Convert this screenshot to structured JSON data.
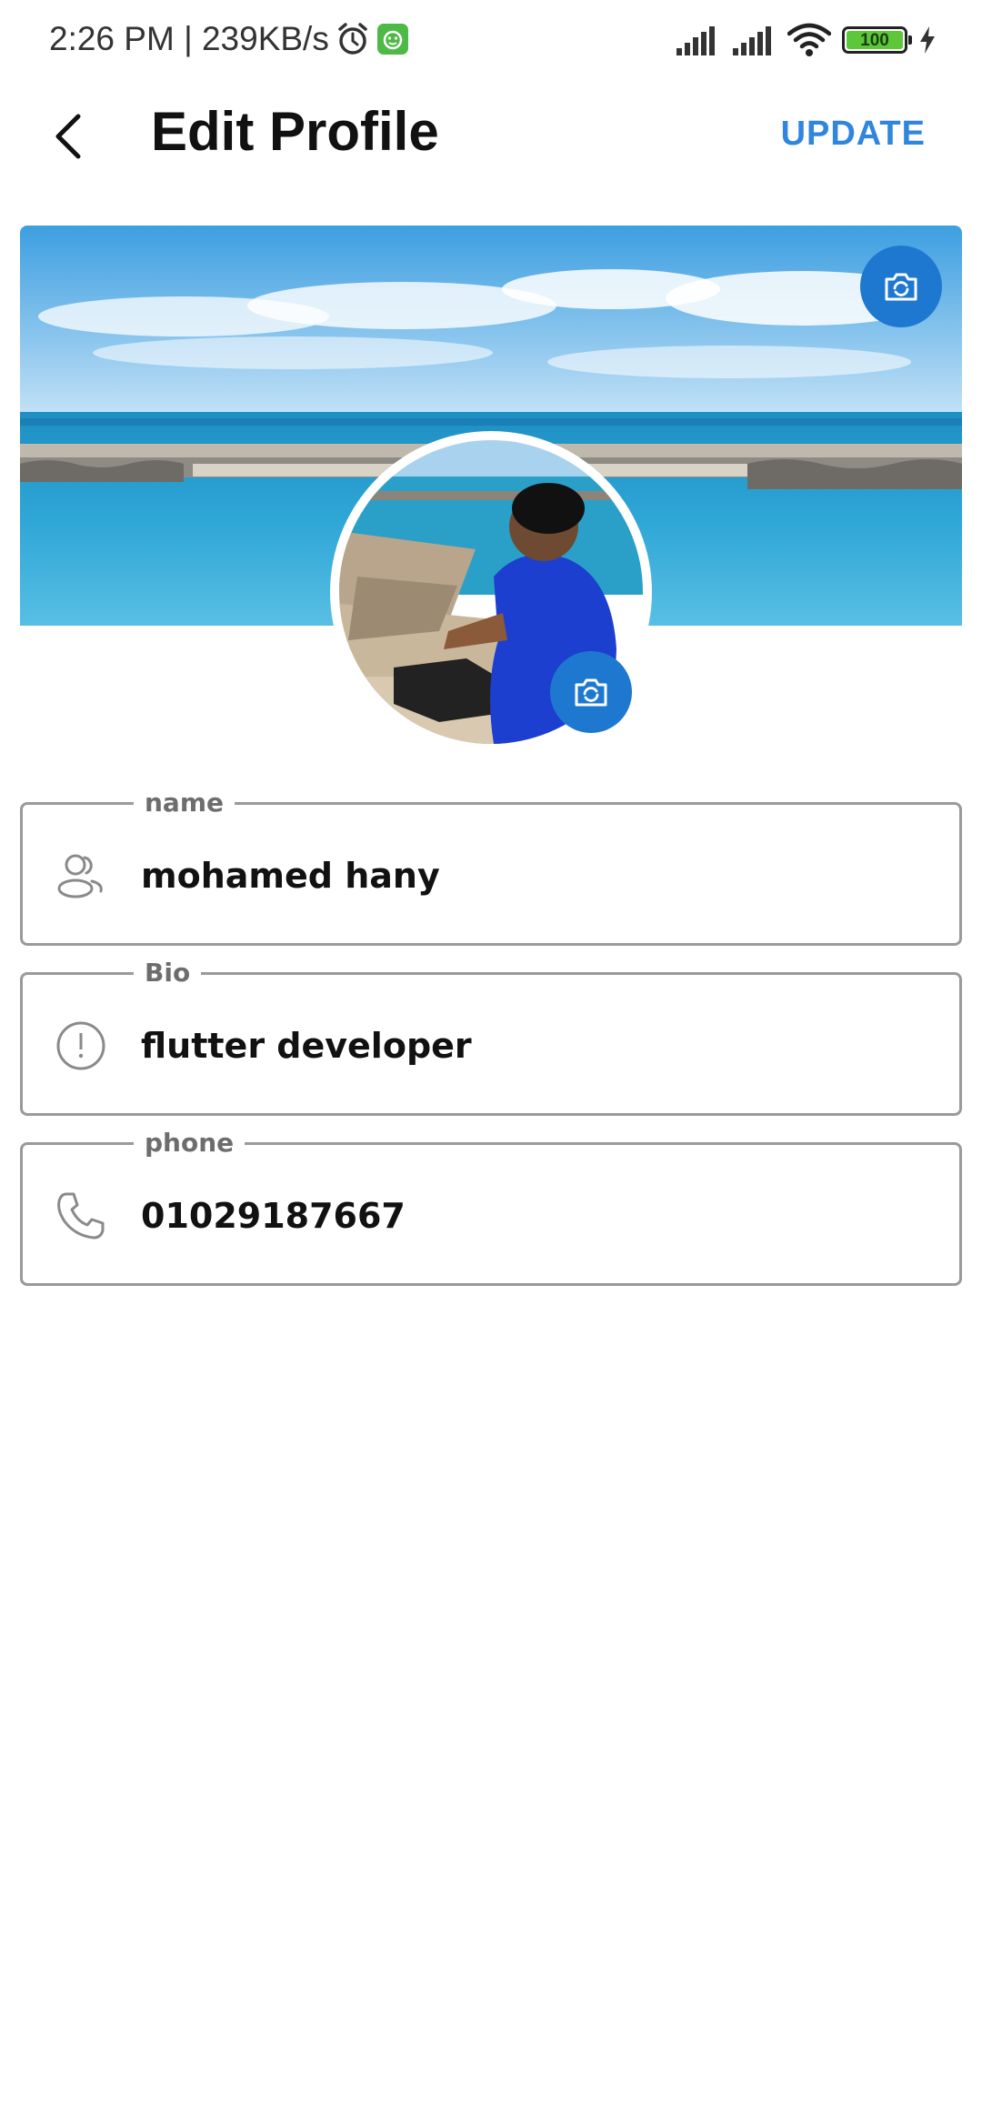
{
  "status_bar": {
    "time_speed": "2:26 PM | 239KB/s",
    "battery_level": "100",
    "icons": [
      "alarm-icon",
      "app-notification-icon",
      "signal-icon",
      "signal-icon",
      "wifi-icon",
      "battery-icon",
      "charging-icon"
    ]
  },
  "app_bar": {
    "title": "Edit Profile",
    "update_label": "UPDATE",
    "back_icon": "chevron-left-icon"
  },
  "profile": {
    "cover_camera_icon": "camera-icon",
    "avatar_camera_icon": "camera-icon"
  },
  "form": {
    "name": {
      "label": "name",
      "value": "mohamed hany",
      "icon": "users-icon"
    },
    "bio": {
      "label": "Bio",
      "value": "flutter developer",
      "icon": "alert-circle-icon"
    },
    "phone": {
      "label": "phone",
      "value": "01029187667",
      "icon": "phone-icon"
    }
  },
  "colors": {
    "accent": "#2f86dc",
    "camera_button": "#1e78d0",
    "field_border": "#9a9a9a",
    "label_text": "#6d6d6d",
    "value_text": "#111111"
  }
}
